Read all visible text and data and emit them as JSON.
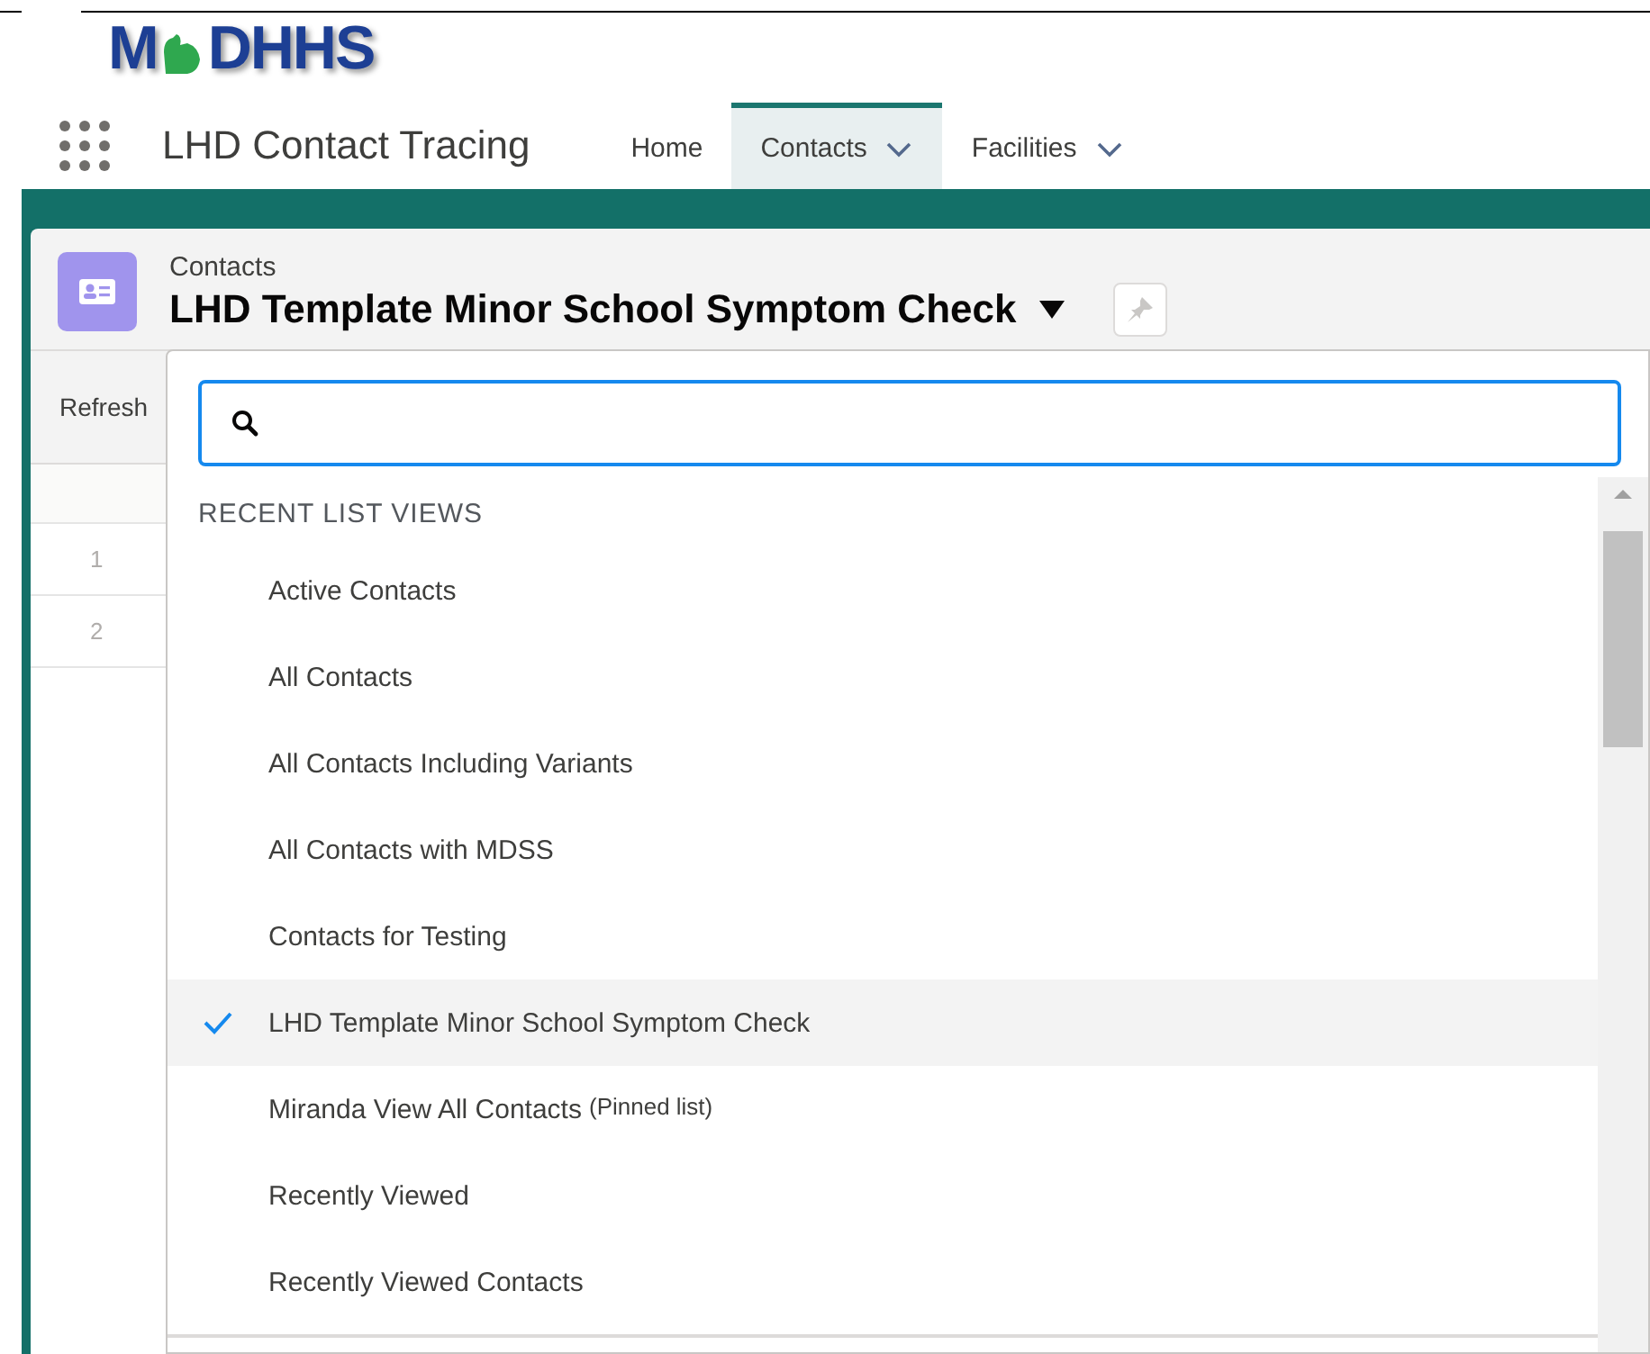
{
  "logo": {
    "text_start": "M",
    "text_end": "DHHS"
  },
  "app": {
    "title": "LHD Contact Tracing"
  },
  "tabs": [
    {
      "label": "Home",
      "selected": false,
      "has_menu": false
    },
    {
      "label": "Contacts",
      "selected": true,
      "has_menu": true
    },
    {
      "label": "Facilities",
      "selected": false,
      "has_menu": true
    }
  ],
  "header": {
    "object": "Contacts",
    "list_view": "LHD Template Minor School Symptom Check"
  },
  "toolbar": {
    "refresh": "Refresh"
  },
  "row_numbers": [
    "1",
    "2"
  ],
  "dropdown": {
    "section": "RECENT LIST VIEWS",
    "items": [
      {
        "label": "Active Contacts",
        "selected": false
      },
      {
        "label": "All Contacts",
        "selected": false
      },
      {
        "label": "All Contacts Including Variants",
        "selected": false
      },
      {
        "label": "All Contacts with MDSS",
        "selected": false
      },
      {
        "label": "Contacts for Testing",
        "selected": false
      },
      {
        "label": "LHD Template Minor School Symptom Check",
        "selected": true
      },
      {
        "label": "Miranda View All Contacts",
        "note": "(Pinned list)",
        "selected": false
      },
      {
        "label": "Recently Viewed",
        "selected": false
      },
      {
        "label": "Recently Viewed Contacts",
        "selected": false
      }
    ]
  }
}
